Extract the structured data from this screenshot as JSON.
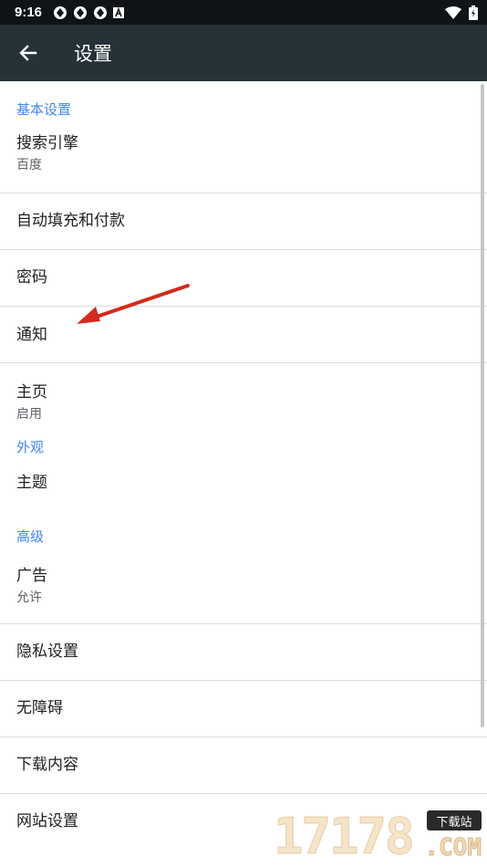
{
  "status": {
    "time": "9:16"
  },
  "appbar": {
    "title": "设置"
  },
  "sections": {
    "basic": "基本设置",
    "appearance": "外观",
    "advanced": "高级"
  },
  "items": {
    "search_engine": {
      "title": "搜索引擎",
      "sub": "百度"
    },
    "autofill": {
      "title": "自动填充和付款"
    },
    "passwords": {
      "title": "密码"
    },
    "notifications": {
      "title": "通知"
    },
    "homepage": {
      "title": "主页",
      "sub": "启用"
    },
    "theme": {
      "title": "主题"
    },
    "ads": {
      "title": "广告",
      "sub": "允许"
    },
    "privacy": {
      "title": "隐私设置"
    },
    "accessibility": {
      "title": "无障碍"
    },
    "downloads": {
      "title": "下载内容"
    },
    "site_settings": {
      "title": "网站设置"
    }
  },
  "watermark": {
    "number": "17178",
    "badge": "下载站",
    "suffix": ".COM"
  },
  "colors": {
    "appbar": "#263238",
    "statusbar": "#0f1417",
    "section": "#4285f4",
    "arrow": "#d42a1e"
  }
}
